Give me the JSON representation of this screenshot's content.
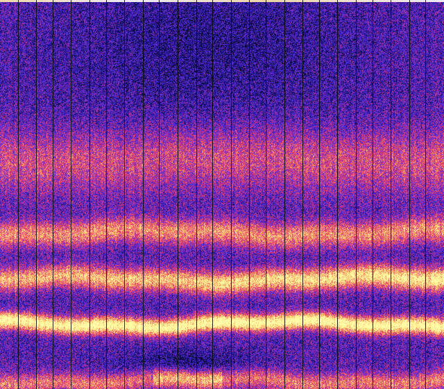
{
  "image": {
    "kind": "spectrogram-waterfall",
    "colormap": [
      "#000000",
      "#0a0a46",
      "#2a1cb4",
      "#5a2ee0",
      "#b0309a",
      "#f0406c",
      "#ff8c5a",
      "#ffe17a",
      "#fffcaa"
    ],
    "vertical_gridline_count": 24,
    "bands": [
      {
        "name": "upper-haze",
        "position": "upper-middle",
        "intensity": 0.35
      },
      {
        "name": "magenta-band",
        "position": "middle",
        "intensity": 0.55
      },
      {
        "name": "pink-yellow-band",
        "position": "lower-middle",
        "intensity": 0.75
      },
      {
        "name": "bright-yellow-band",
        "position": "lower",
        "intensity": 0.98
      },
      {
        "name": "bottom-glow",
        "position": "bottom",
        "intensity": 0.7
      }
    ]
  }
}
